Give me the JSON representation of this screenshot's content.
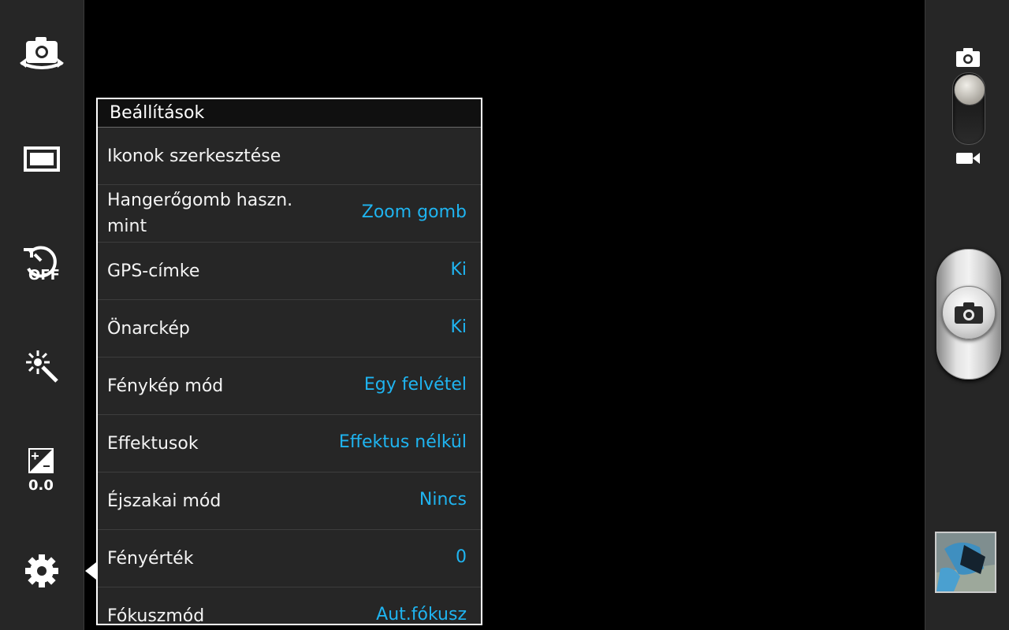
{
  "left_toolbar": {
    "items": [
      {
        "name": "switch-camera-icon"
      },
      {
        "name": "shooting-mode-icon"
      },
      {
        "name": "timer-icon",
        "label": "OFF"
      },
      {
        "name": "scene-mode-icon"
      },
      {
        "name": "exposure-icon",
        "label": "0.0"
      },
      {
        "name": "settings-gear-icon"
      }
    ]
  },
  "settings": {
    "title": "Beállítások",
    "items": [
      {
        "label": "Ikonok szerkesztése",
        "value": ""
      },
      {
        "label": "Hangerőgomb haszn. mint",
        "value": "Zoom gomb"
      },
      {
        "label": "GPS-címke",
        "value": "Ki"
      },
      {
        "label": "Önarckép",
        "value": "Ki"
      },
      {
        "label": "Fénykép mód",
        "value": "Egy felvétel"
      },
      {
        "label": "Effektusok",
        "value": "Effektus nélkül"
      },
      {
        "label": "Éjszakai mód",
        "value": "Nincs"
      },
      {
        "label": "Fényérték",
        "value": "0"
      },
      {
        "label": "Fókuszmód",
        "value": "Aut.fókusz"
      }
    ]
  },
  "right_bar": {
    "mode": "camera",
    "icons": [
      "camera-icon",
      "video-icon",
      "shutter-camera-icon"
    ]
  },
  "colors": {
    "value_text": "#1fb4f0",
    "panel_bg": "#262626",
    "toolbar_bg": "#262626"
  }
}
